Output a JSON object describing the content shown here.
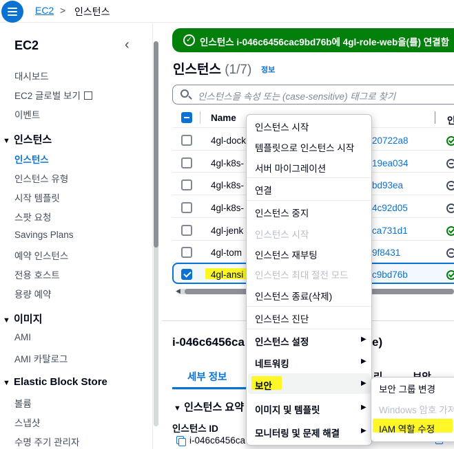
{
  "breadcrumb": {
    "service": "EC2",
    "separator": ">",
    "current": "인스턴스"
  },
  "sidebar": {
    "title": "EC2",
    "items": [
      {
        "label": "대시보드"
      },
      {
        "label": "EC2 글로벌 보기"
      },
      {
        "label": "이벤트"
      }
    ],
    "sections": [
      {
        "title": "인스턴스",
        "items": [
          "인스턴스",
          "인스턴스 유형",
          "시작 템플릿",
          "스팟 요청",
          "Savings Plans",
          "예약 인스턴스",
          "전용 호스트",
          "용량 예약"
        ]
      },
      {
        "title": "이미지",
        "items": [
          "AMI",
          "AMI 카탈로그"
        ]
      },
      {
        "title": "Elastic Block Store",
        "items": [
          "볼륨",
          "스냅샷",
          "수명 주기 관리자"
        ]
      }
    ]
  },
  "flash": {
    "message": "인스턴스 i-046c6456cac9bd76b에 4gl-role-web을(를) 연결함"
  },
  "page": {
    "title": "인스턴스",
    "count": "(1/7)",
    "info": "정보"
  },
  "search": {
    "placeholder": "인스턴스을 속성 또는 (case-sensitive) 태그로 찾기"
  },
  "table": {
    "header_name": "Name",
    "header_last": "인",
    "rows": [
      {
        "name": "4gl-dock",
        "id": "20722a8",
        "checked": false
      },
      {
        "name": "4gl-k8s-",
        "id": "19ea034",
        "checked": false
      },
      {
        "name": "4gl-k8s-",
        "id": "bd93ea",
        "checked": false
      },
      {
        "name": "4gl-k8s-",
        "id": "4c92d05",
        "checked": false
      },
      {
        "name": "4gl-jenk",
        "id": "ca731d1",
        "checked": false
      },
      {
        "name": "4gl-tom",
        "id": "9f8431",
        "checked": false
      },
      {
        "name": "4gl-ansi",
        "id": "c9bd76b",
        "checked": true
      }
    ]
  },
  "details": {
    "instance_id": "i-046c6456ca",
    "instance_id_tail": "e)",
    "tabs": [
      "세부 정보",
      "리",
      "보안"
    ],
    "summary": "인스턴스 요약",
    "label_id": "인스턴스 ID",
    "value_id": "i-046c6456ca"
  },
  "context_menu": {
    "items": [
      {
        "label": "인스턴스 시작",
        "disabled": false
      },
      {
        "label": "템플릿으로 인스턴스 시작",
        "disabled": false
      },
      {
        "label": "서버 마이그레이션",
        "disabled": false
      },
      {
        "label": "연결",
        "disabled": false
      },
      {
        "label": "인스턴스 중지",
        "disabled": false
      },
      {
        "label": "인스턴스 시작",
        "disabled": true
      },
      {
        "label": "인스턴스 재부팅",
        "disabled": false
      },
      {
        "label": "인스턴스 최대 절전 모드",
        "disabled": true
      },
      {
        "label": "인스턴스 종료(삭제)",
        "disabled": false
      },
      {
        "label": "인스턴스 진단",
        "disabled": false
      },
      {
        "label": "인스턴스 설정",
        "submenu": true
      },
      {
        "label": "네트워킹",
        "submenu": true
      },
      {
        "label": "보안",
        "submenu": true
      },
      {
        "label": "이미지 및 템플릿",
        "submenu": true
      },
      {
        "label": "모니터링 및 문제 해결",
        "submenu": true
      }
    ]
  },
  "security_submenu": {
    "items": [
      {
        "label": "보안 그룹 변경",
        "disabled": false
      },
      {
        "label": "Windows 암호 가져",
        "disabled": true
      },
      {
        "label": "IAM 역할 수정",
        "disabled": false
      }
    ]
  },
  "colors": {
    "accent": "#0972d3",
    "success": "#037f0c",
    "highlight": "#fff700"
  }
}
